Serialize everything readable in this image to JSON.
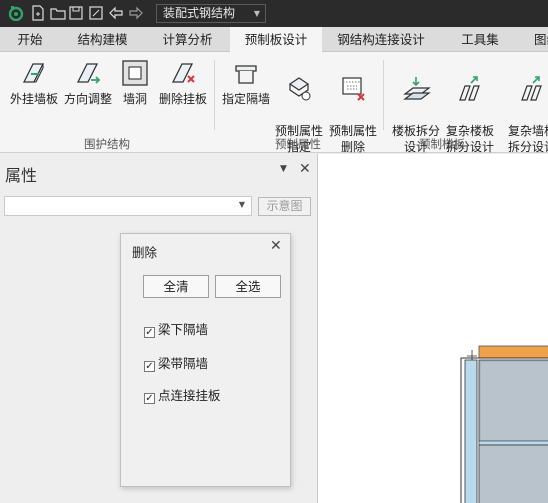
{
  "titlebar": {
    "icons": [
      "app-logo-icon",
      "new-file-icon",
      "open-folder-icon",
      "save-icon",
      "save-as-icon",
      "undo-icon",
      "redo-icon"
    ],
    "project_type": "装配式钢结构"
  },
  "tabs": [
    {
      "label": "开始"
    },
    {
      "label": "结构建模"
    },
    {
      "label": "计算分析"
    },
    {
      "label": "预制板设计",
      "active": true
    },
    {
      "label": "钢结构连接设计"
    },
    {
      "label": "工具集"
    },
    {
      "label": "图纸"
    }
  ],
  "ribbon": {
    "groups": [
      {
        "label": "围护结构",
        "buttons": [
          "外挂墙板",
          "方向调整",
          "墙洞",
          "删除挂板"
        ]
      },
      {
        "label": "预制属性",
        "buttons": [
          "指定隔墙",
          "预制属性\n指定",
          "预制属性\n删除"
        ]
      },
      {
        "label": "预制楼板",
        "buttons": [
          "楼板拆分\n设计",
          "复杂楼板\n拆分设计",
          "复杂墙板\n拆分设计"
        ]
      }
    ]
  },
  "properties": {
    "title": "属性",
    "combo_value": "",
    "schematic_button": "示意图"
  },
  "dialog": {
    "title": "删除",
    "clear_all": "全清",
    "select_all": "全选",
    "options": [
      {
        "label": "梁下隔墙",
        "checked": true
      },
      {
        "label": "梁带隔墙",
        "checked": true
      },
      {
        "label": "点连接挂板",
        "checked": true
      }
    ]
  },
  "colors": {
    "titlebar": "#2b2b2b",
    "accent_green": "#2fa36b",
    "wall_blue": "#b9d9ec",
    "wall_orange": "#f0a24a"
  }
}
